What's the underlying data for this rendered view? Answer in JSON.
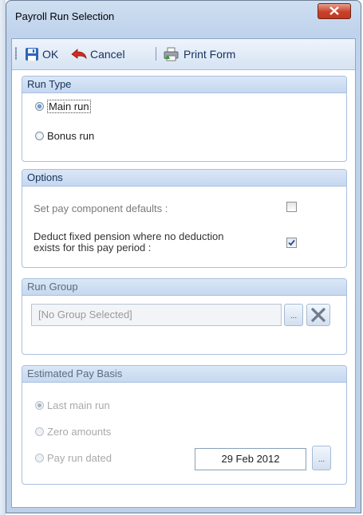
{
  "window": {
    "title": "Payroll Run Selection"
  },
  "toolbar": {
    "ok_label": "OK",
    "cancel_label": "Cancel",
    "print_label": "Print Form"
  },
  "run_type": {
    "heading": "Run Type",
    "options": [
      {
        "label": "Main run",
        "checked": true
      },
      {
        "label": "Bonus run",
        "checked": false
      }
    ]
  },
  "options": {
    "heading": "Options",
    "set_defaults_label": "Set pay component defaults :",
    "set_defaults_checked": false,
    "deduct_pension_label_line1": "Deduct fixed pension where no deduction",
    "deduct_pension_label_line2": "exists for this pay period :",
    "deduct_pension_checked": true
  },
  "run_group": {
    "heading": "Run Group",
    "value": "[No Group Selected]",
    "browse_label": "..."
  },
  "estimated_pay_basis": {
    "heading": "Estimated Pay Basis",
    "options": [
      {
        "label": "Last main run",
        "checked": true
      },
      {
        "label": "Zero amounts",
        "checked": false
      },
      {
        "label": "Pay run dated",
        "checked": false
      }
    ],
    "date_value": "29 Feb 2012",
    "date_browse_label": "..."
  },
  "colors": {
    "accent": "#c5d8f0",
    "close": "#c7412a"
  }
}
